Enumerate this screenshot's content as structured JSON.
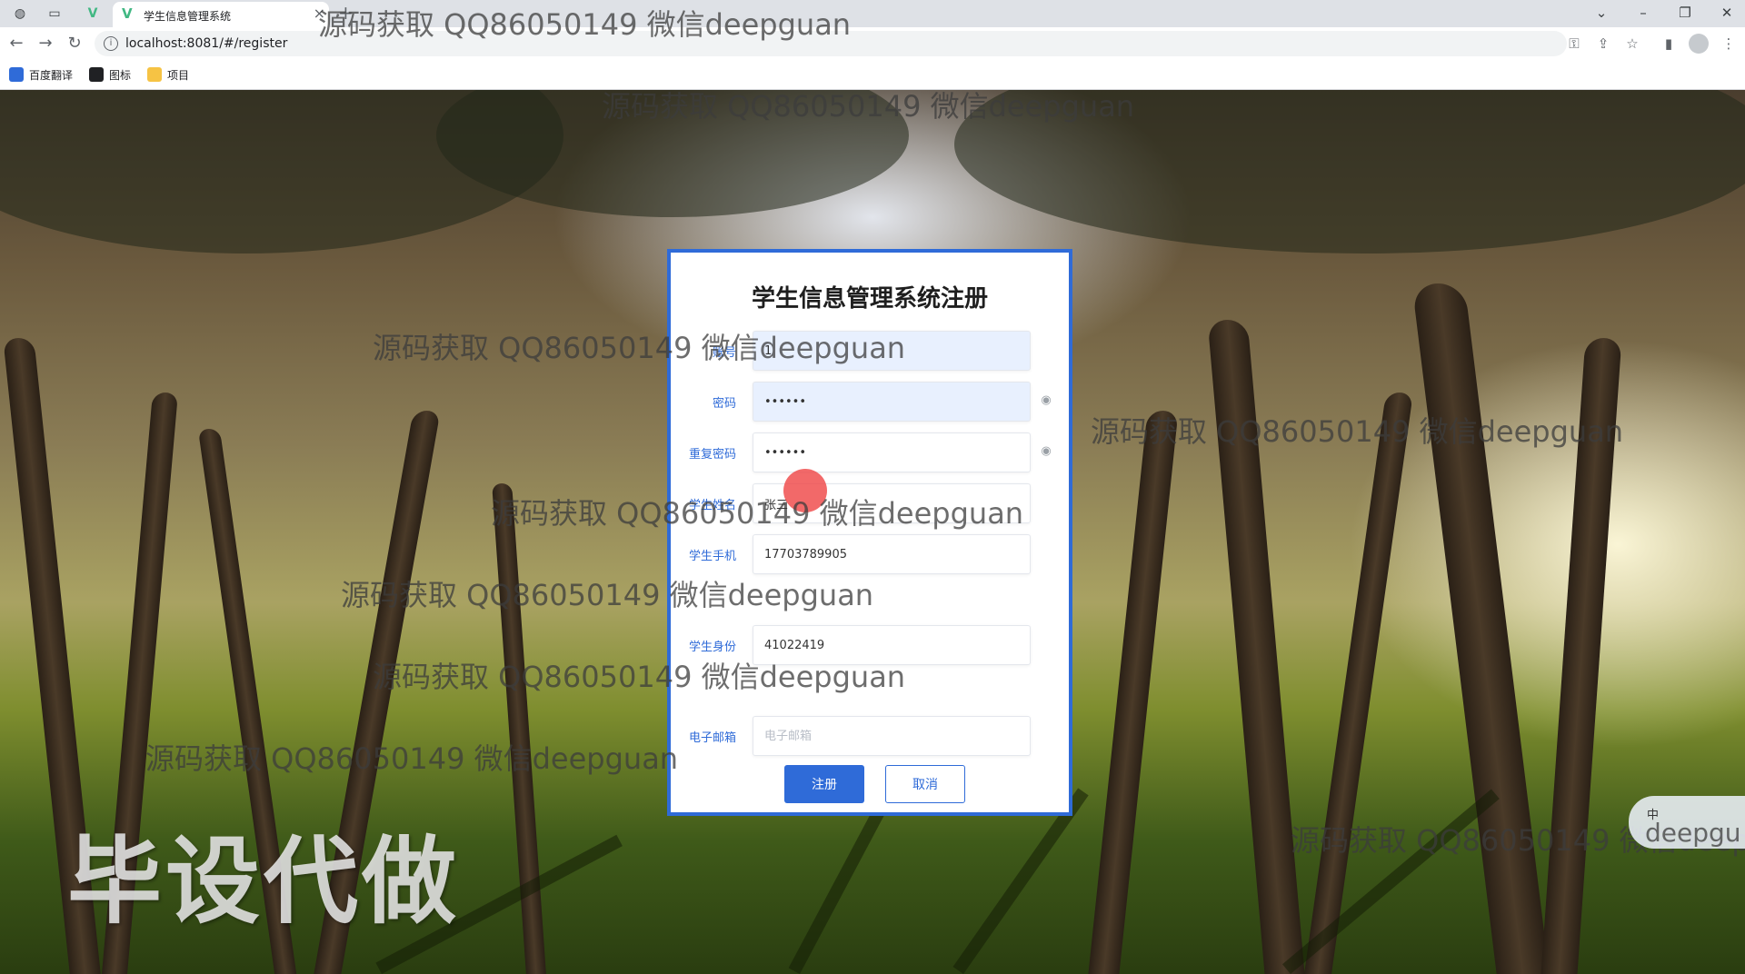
{
  "browser": {
    "tab_title": "学生信息管理系统",
    "url": "localhost:8081/#/register",
    "bookmarks": [
      "百度翻译",
      "图标",
      "项目"
    ]
  },
  "form": {
    "title": "学生信息管理系统注册",
    "fields": [
      {
        "label": "账号",
        "value": "1",
        "placeholder": ""
      },
      {
        "label": "密码",
        "value": "••••••",
        "placeholder": ""
      },
      {
        "label": "重复密码",
        "value": "••••••",
        "placeholder": ""
      },
      {
        "label": "学生姓名",
        "value": "张三",
        "placeholder": ""
      },
      {
        "label": "学生手机",
        "value": "17703789905",
        "placeholder": ""
      },
      {
        "label": "学生身份",
        "value": "41022419",
        "placeholder": ""
      },
      {
        "label": "电子邮箱",
        "value": "",
        "placeholder": "电子邮箱"
      }
    ],
    "register_label": "注册",
    "cancel_label": "取消"
  },
  "overlay": {
    "watermark": "源码获取 QQ86050149 微信deepguan",
    "big_mark": "毕设代做",
    "ime_indicator": "中",
    "ime_word": "deepgu"
  },
  "colors": {
    "accent": "#2f6bd8",
    "cursor_highlight": "#ef4444"
  }
}
